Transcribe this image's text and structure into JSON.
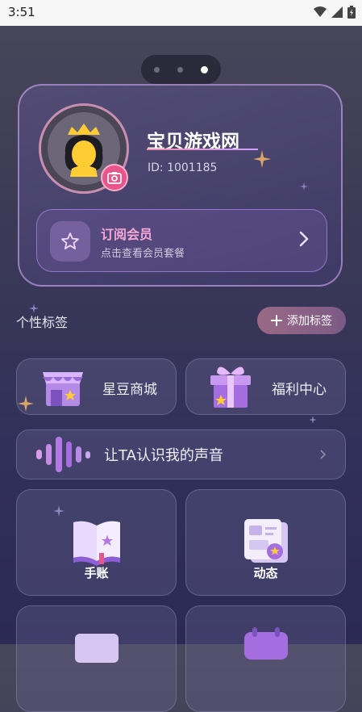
{
  "status_bar": {
    "time": "3:51"
  },
  "profile": {
    "name": "宝贝游戏网",
    "id_text": "ID: 1001185"
  },
  "vip": {
    "title": "订阅会员",
    "subtitle": "点击查看会员套餐"
  },
  "tags": {
    "label": "个性标签",
    "add_button": "添加标签"
  },
  "shortcuts": [
    {
      "label": "星豆商城",
      "icon": "shop-icon"
    },
    {
      "label": "福利中心",
      "icon": "gift-icon"
    }
  ],
  "voice": {
    "label": "让TA认识我的声音",
    "icon": "voice-wave-icon"
  },
  "features": [
    {
      "label": "手账",
      "icon": "book-icon"
    },
    {
      "label": "动态",
      "icon": "news-icon"
    }
  ],
  "colors": {
    "accent_pink": "#f7a7d6",
    "camera_pink": "#e8558a",
    "background": "#3b3a56"
  }
}
